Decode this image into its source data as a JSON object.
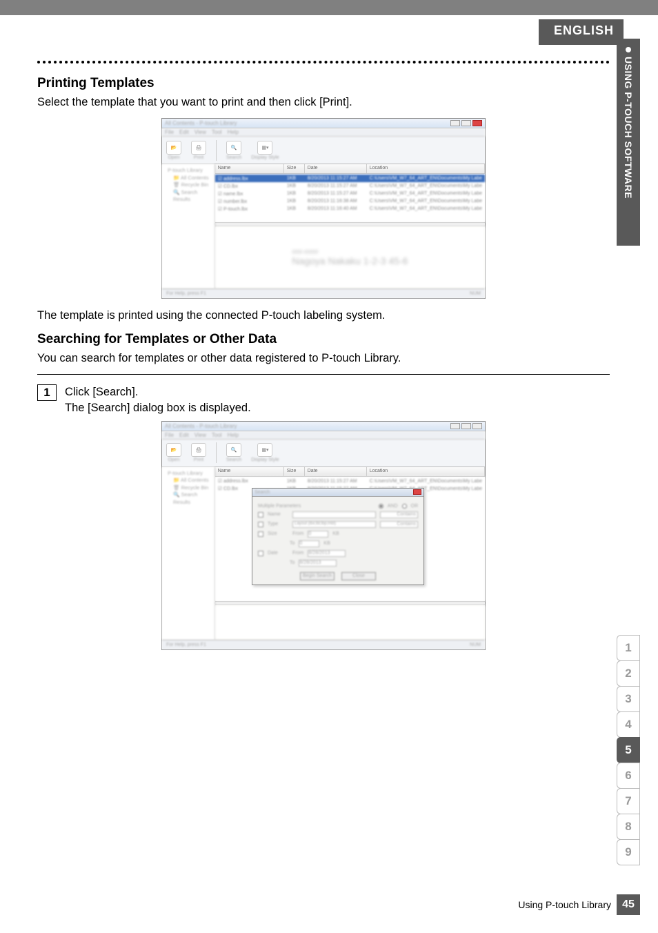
{
  "header": {
    "language": "ENGLISH",
    "side_tab": "USING P-TOUCH SOFTWARE"
  },
  "section1": {
    "heading": "Printing Templates",
    "body": "Select the template that you want to print and then click [Print].",
    "after": "The template is printed using the connected P-touch labeling system."
  },
  "section2": {
    "heading": "Searching for Templates or Other Data",
    "body": "You can search for templates or other data registered to P-touch Library."
  },
  "step1": {
    "num": "1",
    "line1": "Click [Search].",
    "line2": "The [Search] dialog box is displayed."
  },
  "app": {
    "title": "All Contents - P-touch Library",
    "menus": [
      "File",
      "Edit",
      "View",
      "Tool",
      "Help"
    ],
    "toolbar": {
      "open": "Open",
      "print": "Print",
      "search": "Search",
      "display": "Display Style"
    },
    "tree": {
      "root": "P-touch Library",
      "items": [
        "All Contents",
        "Recycle Bin",
        "Search Results"
      ]
    },
    "columns": {
      "name": "Name",
      "size": "Size",
      "date": "Date",
      "location": "Location"
    },
    "rows1": [
      {
        "name": "address.lbx",
        "size": "1KB",
        "date": "8/20/2013 11:15:27 AM",
        "loc": "C:\\Users\\VM_W7_64_ART_EN\\Documents\\My Labe",
        "selected": true
      },
      {
        "name": "CD.lbx",
        "size": "1KB",
        "date": "8/20/2013 11:15:27 AM",
        "loc": "C:\\Users\\VM_W7_64_ART_EN\\Documents\\My Labe"
      },
      {
        "name": "name.lbx",
        "size": "1KB",
        "date": "8/20/2013 11:15:27 AM",
        "loc": "C:\\Users\\VM_W7_64_ART_EN\\Documents\\My Labe"
      },
      {
        "name": "number.lbx",
        "size": "1KB",
        "date": "8/20/2013 11:16:38 AM",
        "loc": "C:\\Users\\VM_W7_64_ART_EN\\Documents\\My Labe"
      },
      {
        "name": "P-touch.lbx",
        "size": "1KB",
        "date": "8/20/2013 11:16:40 AM",
        "loc": "C:\\Users\\VM_W7_64_ART_EN\\Documents\\My Labe"
      }
    ],
    "rows2": [
      {
        "name": "address.lbx",
        "size": "1KB",
        "date": "8/20/2013 11:15:27 AM",
        "loc": "C:\\Users\\VM_W7_64_ART_EN\\Documents\\My Labe"
      },
      {
        "name": "CD.lbx",
        "size": "1KB",
        "date": "8/20/2013 11:15:27 AM",
        "loc": "C:\\Users\\VM_W7_64_ART_EN\\Documents\\My Labe"
      }
    ],
    "preview_text": "Nagoya Nakaku 1-2-3 45-6",
    "status_left": "For Help, press F1",
    "status_right": "NUM",
    "search_dialog": {
      "title": "Search",
      "params": "Multiple Parameters",
      "and": "AND",
      "or": "OR",
      "name": "Name",
      "type": "Type",
      "type_value": "Layout (lbx;lbl;lbp;mbl)",
      "size": "Size",
      "from": "From",
      "to": "To",
      "kb": "KB",
      "date": "Date",
      "contains": "Contains",
      "begin": "Begin Search",
      "close": "Close",
      "date_value": "8/28/2013"
    }
  },
  "index": {
    "tabs": [
      "1",
      "2",
      "3",
      "4",
      "5",
      "6",
      "7",
      "8",
      "9"
    ],
    "active": "5"
  },
  "footer": {
    "text": "Using P-touch Library",
    "page": "45"
  }
}
